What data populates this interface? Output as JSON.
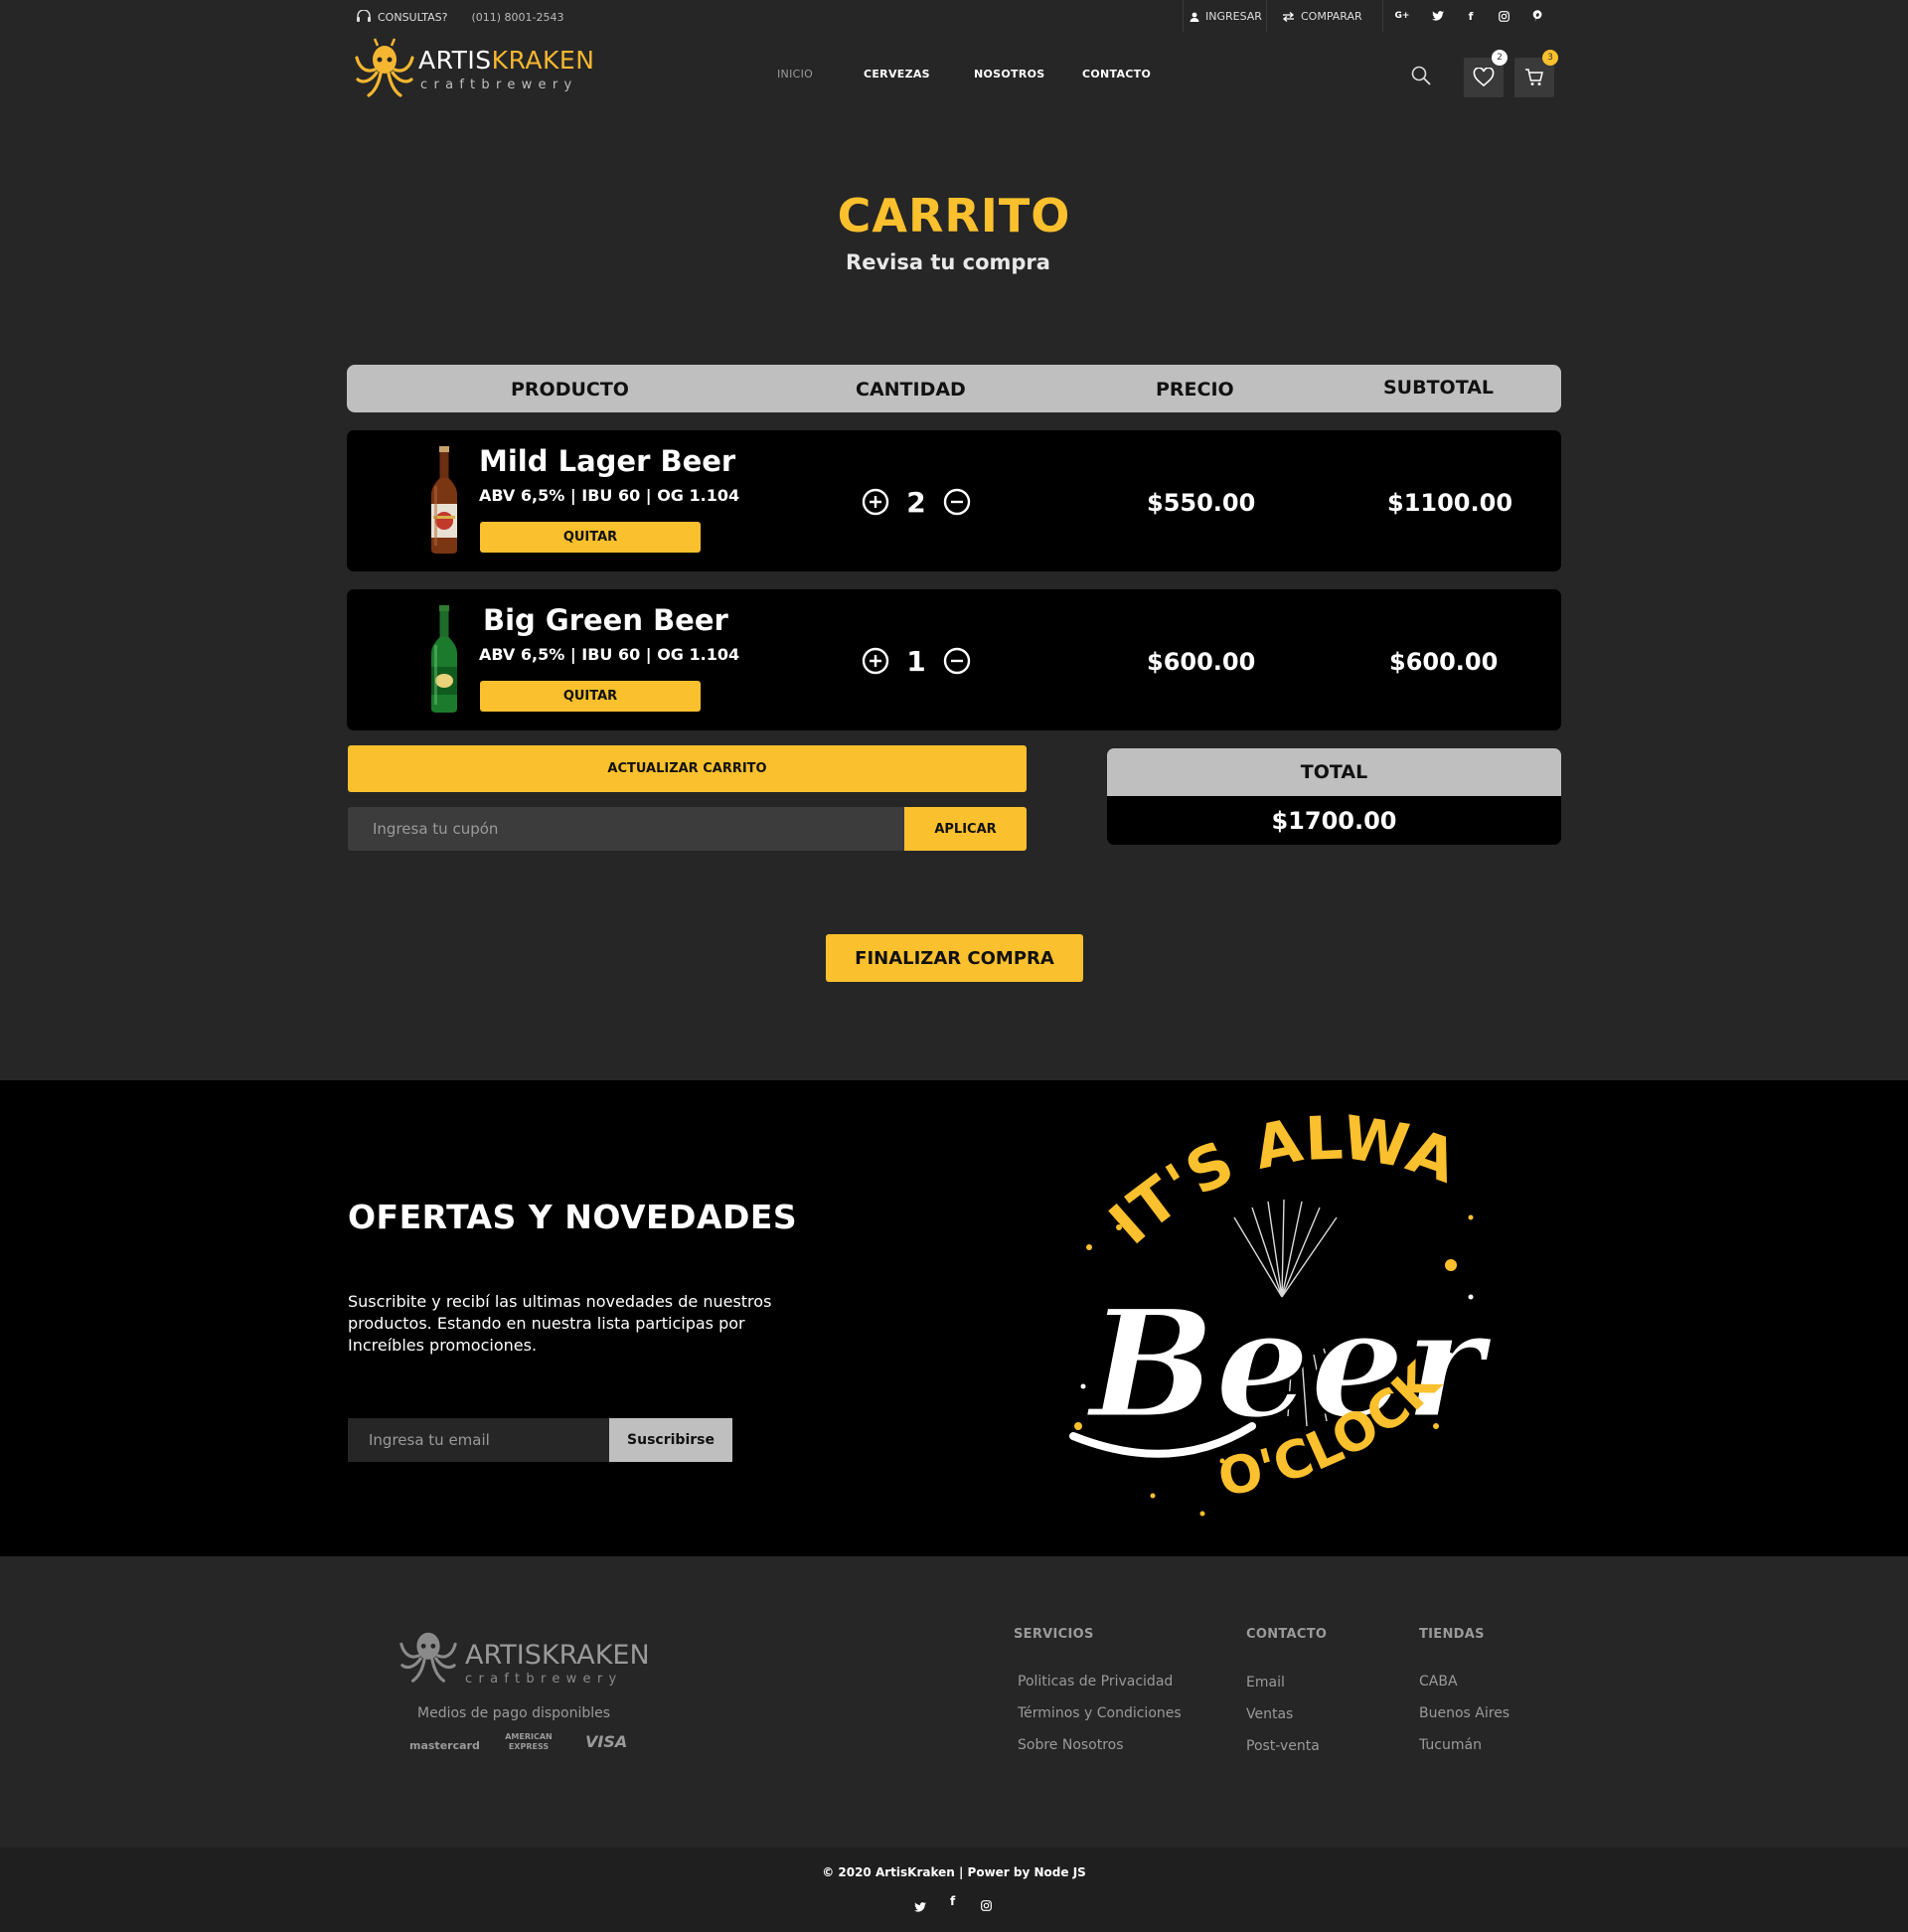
{
  "topbar": {
    "consultas": "CONSULTAS?",
    "phone": "(011) 8001-2543",
    "login": "INGRESAR",
    "compare": "COMPARAR",
    "social": [
      "G+",
      "twitter",
      "facebook",
      "instagram",
      "pinterest"
    ]
  },
  "brand": {
    "name_a": "ARTIS",
    "name_b": "KRAKEN",
    "sub": "craftbrewery"
  },
  "nav": [
    "INICIO",
    "CERVEZAS",
    "NOSOTROS",
    "CONTACTO"
  ],
  "header": {
    "wishlist_count": "2",
    "cart_count": "3"
  },
  "page": {
    "title": "CARRITO",
    "subtitle": "Revisa tu compra"
  },
  "table": {
    "headers": [
      "PRODUCTO",
      "CANTIDAD",
      "PRECIO",
      "SUBTOTAL"
    ]
  },
  "items": [
    {
      "name": "Mild Lager Beer",
      "specs": "ABV 6,5% | IBU 60 | OG 1.104",
      "remove": "QUITAR",
      "qty": "2",
      "price": "$550.00",
      "subtotal": "$1100.00"
    },
    {
      "name": "Big Green Beer",
      "specs": "ABV 6,5% | IBU 60 | OG 1.104",
      "remove": "QUITAR",
      "qty": "1",
      "price": "$600.00",
      "subtotal": "$600.00"
    }
  ],
  "cart": {
    "update": "ACTUALIZAR CARRITO",
    "coupon_placeholder": "Ingresa tu cupón",
    "apply": "APLICAR",
    "total_label": "TOTAL",
    "total_value": "$1700.00",
    "checkout": "FINALIZAR COMPRA"
  },
  "newsletter": {
    "title": "OFERTAS Y NOVEDADES",
    "text": "Suscribite y recibí las ultimas novedades de nuestros productos. Estando en nuestra lista participas por Increíbles promociones.",
    "email_placeholder": "Ingresa tu email",
    "button": "Suscribirse",
    "art_line1": "IT'S ALWAYS",
    "art_line2": "Beer",
    "art_line3": "O'CLOCK"
  },
  "footer": {
    "payments_label": "Medios de pago disponibles",
    "payments": [
      "mastercard",
      "AMERICAN EXPRESS",
      "VISA"
    ],
    "servicios": {
      "title": "SERVICIOS",
      "links": [
        "Politicas de Privacidad",
        "Términos y Condiciones",
        "Sobre Nosotros"
      ]
    },
    "contacto": {
      "title": "CONTACTO",
      "links": [
        "Email",
        "Ventas",
        "Post-venta"
      ]
    },
    "tiendas": {
      "title": "TIENDAS",
      "links": [
        "CABA",
        "Buenos Aires",
        "Tucumán"
      ]
    },
    "copyright": "© 2020 ArtisKraken | Power by Node JS"
  },
  "colors": {
    "accent": "#fbc02d",
    "bg": "#262626",
    "panel": "#000000",
    "header_gray": "#bfbfbf"
  }
}
